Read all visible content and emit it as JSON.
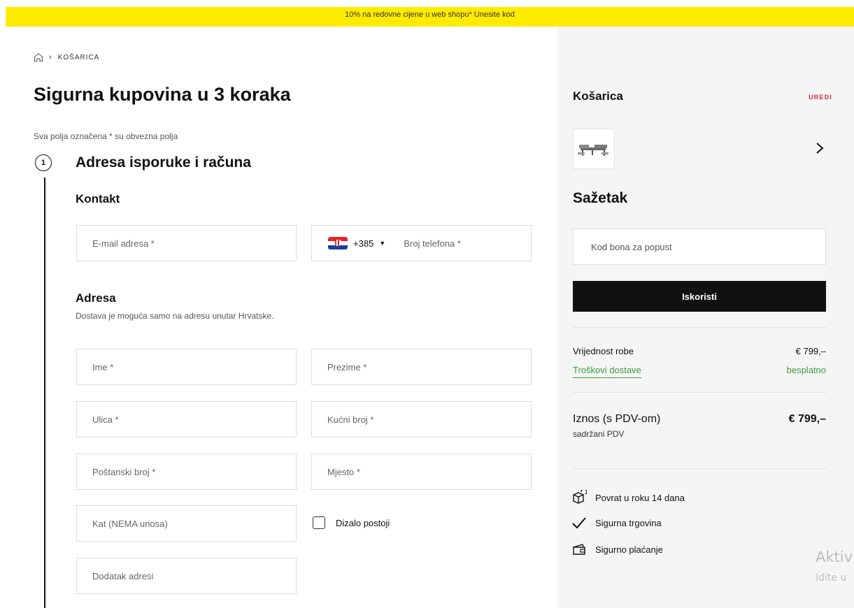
{
  "promo": {
    "text": "10% na redovne cijene u web shopu* Unesite kod"
  },
  "breadcrumb": {
    "current": "KOŠARICA"
  },
  "page": {
    "title": "Sigurna kupovina u 3 koraka",
    "required_note": "Sva polja označena * su obvezna polja"
  },
  "step": {
    "number": "1",
    "title": "Adresa isporuke i računa"
  },
  "contact": {
    "title": "Kontakt",
    "email_placeholder": "E-mail adresa *",
    "dial_code": "+385",
    "phone_placeholder": "Broj telefona *"
  },
  "address": {
    "title": "Adresa",
    "subtitle": "Dostava je moguća samo na adresu unutar Hrvatske.",
    "first_name_placeholder": "Ime *",
    "last_name_placeholder": "Prezime *",
    "street_placeholder": "Ulica *",
    "house_number_placeholder": "Kućni broj *",
    "postal_code_placeholder": "Poštanski broj *",
    "city_placeholder": "Mjesto *",
    "floor_placeholder": "Kat (NEMA unosa)",
    "elevator_label": "Dizalo postoji",
    "address_extra_placeholder": "Dodatak adresi"
  },
  "cart": {
    "title": "Košarica",
    "edit_label": "UREDI"
  },
  "summary": {
    "title": "Sažetak",
    "voucher_placeholder": "Kod bona za popust",
    "apply_label": "Iskoristi",
    "goods_label": "Vrijednost robe",
    "goods_value": "€ 799,–",
    "shipping_label": "Troškovi dostave",
    "shipping_value": "besplatno",
    "total_label": "Iznos (s PDV-om)",
    "total_value": "€ 799,–",
    "vat_note": "sadržani PDV"
  },
  "benefits": {
    "return": "Povrat u roku 14 dana",
    "secure_shop": "Sigurna trgovina",
    "secure_payment": "Sigurno plaćanje"
  },
  "watermark": {
    "line1": "Aktiv",
    "line2": "Idite u"
  },
  "colors": {
    "promo_bg": "#ffeb00",
    "accent_red": "#d42b3a",
    "accent_green": "#3e9a3e",
    "button_bg": "#111111",
    "panel_bg": "#f5f5f5"
  }
}
